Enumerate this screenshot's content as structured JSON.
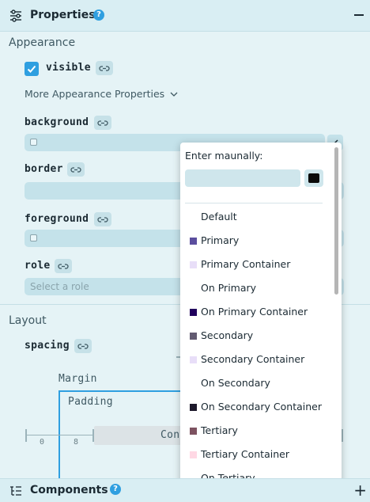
{
  "header": {
    "title": "Properties",
    "help": "?"
  },
  "appearance": {
    "section_title": "Appearance",
    "visible_label": "visible",
    "more_label": "More Appearance Properties",
    "background_label": "background",
    "border_label": "border",
    "foreground_label": "foreground",
    "role_label": "role",
    "role_placeholder": "Select a role"
  },
  "layout": {
    "section_title": "Layout",
    "spacing_label": "spacing",
    "margin_label": "Margin",
    "padding_label": "Padding",
    "content_label": "Con",
    "ruler_0": "0",
    "ruler_8": "8"
  },
  "footer": {
    "title": "Components",
    "help": "?"
  },
  "color_popup": {
    "title": "Enter maunally:",
    "options": [
      {
        "label": "Default",
        "color": ""
      },
      {
        "label": "Primary",
        "color": "#5b4e9e"
      },
      {
        "label": "Primary Container",
        "color": "#e8def8"
      },
      {
        "label": "On Primary",
        "color": ""
      },
      {
        "label": "On Primary Container",
        "color": "#21005d"
      },
      {
        "label": "Secondary",
        "color": "#625b71"
      },
      {
        "label": "Secondary Container",
        "color": "#e8def8"
      },
      {
        "label": "On Secondary",
        "color": ""
      },
      {
        "label": "On Secondary Container",
        "color": "#1d192b"
      },
      {
        "label": "Tertiary",
        "color": "#7d5260"
      },
      {
        "label": "Tertiary Container",
        "color": "#ffd8e4"
      },
      {
        "label": "On Tertiary",
        "color": ""
      }
    ]
  }
}
